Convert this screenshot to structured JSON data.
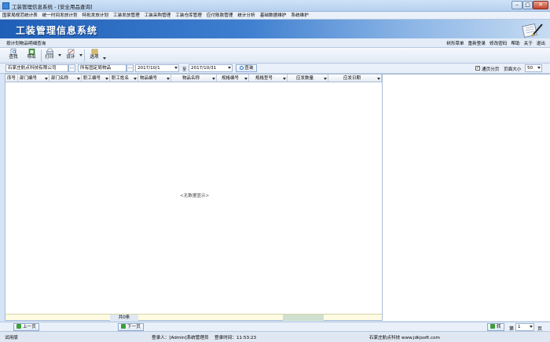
{
  "window": {
    "title": "工装管理信息系统 - [安全用品查询]"
  },
  "menu": [
    "国家局规范统计表",
    "统一时间发放计划",
    "特批发放计划",
    "工装发放管理",
    "工装采购管理",
    "工装仓库管理",
    "应付账款管理",
    "统计分析",
    "基础数据维护",
    "系统维护"
  ],
  "banner": {
    "title": "工装管理信息系统"
  },
  "subnav": {
    "page_title": "按计划物品明细查询",
    "links": [
      "树形菜单",
      "重新登录",
      "修改密码",
      "帮助",
      "关于",
      "退出"
    ]
  },
  "toolbar": {
    "query": "查找",
    "export": "导出",
    "print": "打印",
    "design": "设计",
    "options": "选项"
  },
  "filters": {
    "company": "石家庄航点科技有限公司",
    "items": "所有固定局物品",
    "date_from": "2017/10/1",
    "to_label": "至",
    "date_to": "2017/10/31",
    "query_btn": "查询",
    "paging_label": "通页分页",
    "page_size_label": "页面大小",
    "page_size": "50"
  },
  "grid": {
    "columns": [
      "序号",
      "部门编号",
      "部门名称",
      "职工编号",
      "职工姓名",
      "物品编号",
      "物品名称",
      "规格编号",
      "规格型号",
      "应发数量",
      "应发日期"
    ],
    "empty_text": "<无数据显示>",
    "total_text": "共0条"
  },
  "pager": {
    "prev": "上一页",
    "next": "下一页",
    "go": "转",
    "page_prefix": "第",
    "page_value": "1",
    "page_suffix": "页"
  },
  "status": {
    "left": "试用版",
    "login": "登录人：[Admin]系统管理员",
    "login_time": "登录时间：11:53:23",
    "vendor": "石家庄航点科技  www.jdkjsoft.com"
  }
}
